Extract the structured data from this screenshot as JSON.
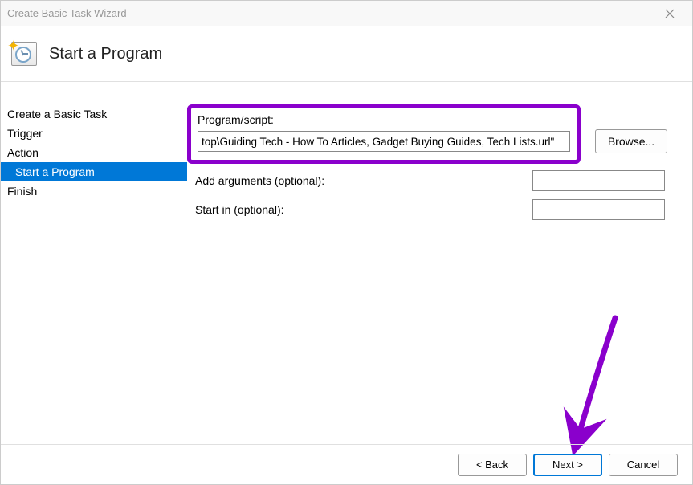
{
  "window": {
    "title": "Create Basic Task Wizard"
  },
  "header": {
    "title": "Start a Program"
  },
  "sidebar": {
    "steps": [
      {
        "label": "Create a Basic Task",
        "active": false,
        "sub": false
      },
      {
        "label": "Trigger",
        "active": false,
        "sub": false
      },
      {
        "label": "Action",
        "active": false,
        "sub": false
      },
      {
        "label": "Start a Program",
        "active": true,
        "sub": true
      },
      {
        "label": "Finish",
        "active": false,
        "sub": false
      }
    ]
  },
  "form": {
    "program_label": "Program/script:",
    "program_value": "top\\Guiding Tech - How To Articles, Gadget Buying Guides, Tech Lists.url\"",
    "browse_label": "Browse...",
    "arguments_label": "Add arguments (optional):",
    "arguments_value": "",
    "startin_label": "Start in (optional):",
    "startin_value": ""
  },
  "footer": {
    "back_label": "< Back",
    "next_label": "Next >",
    "cancel_label": "Cancel"
  },
  "annotation": {
    "highlight_color": "#8a00cc",
    "arrow_color": "#8a00cc"
  }
}
